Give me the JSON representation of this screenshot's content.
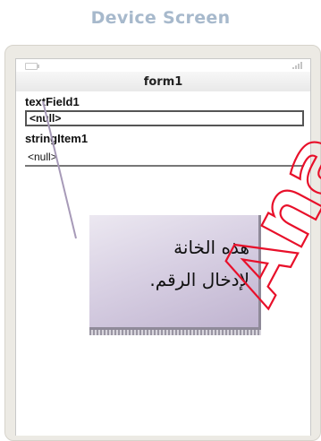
{
  "header": {
    "title": "Device Screen"
  },
  "form": {
    "title": "form1",
    "fields": [
      {
        "label": "textField1",
        "value": "<null>"
      },
      {
        "label": "stringItem1",
        "value": "<null>"
      }
    ]
  },
  "tooltip": {
    "line1": "هذه الخانة",
    "line2": "لإدخال الرقم."
  },
  "watermark": {
    "text": "Ana"
  },
  "colors": {
    "header": "#a7b9cc",
    "tooltip_bg": "#d8d0e3",
    "watermark": "#e8102a"
  }
}
